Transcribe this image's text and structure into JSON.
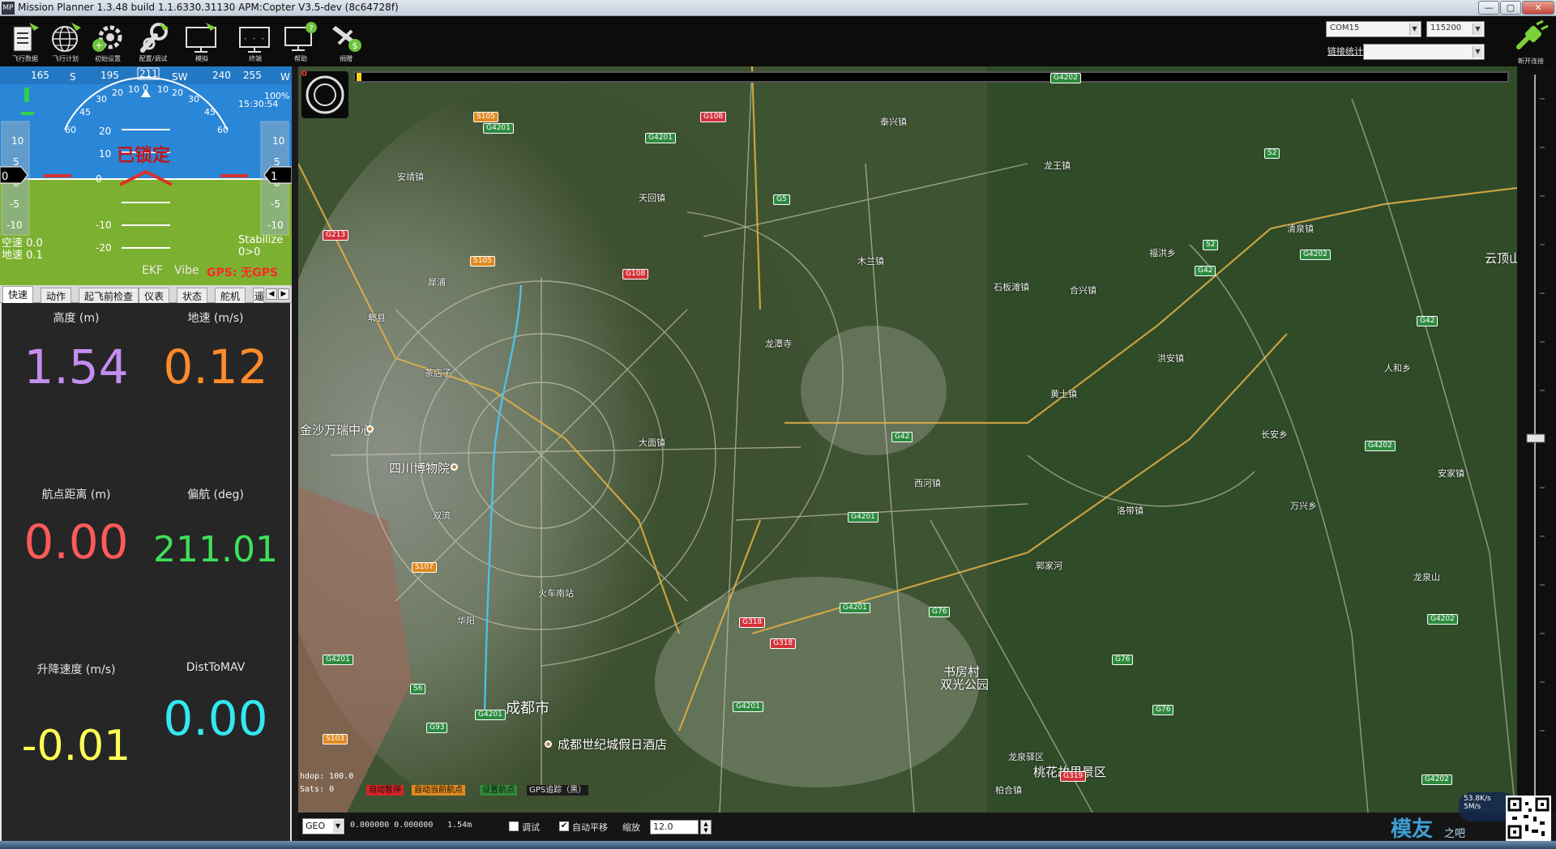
{
  "window": {
    "title": "Mission Planner 1.3.48 build 1.1.6330.31130 APM:Copter V3.5-dev (8c64728f)",
    "app_icon": "mp-app-icon"
  },
  "toolbar": {
    "buttons": [
      {
        "label": "飞行数据",
        "icon": "flight-data-icon"
      },
      {
        "label": "飞行计划",
        "icon": "globe-icon"
      },
      {
        "label": "初始设置",
        "icon": "gear-plus-icon"
      },
      {
        "label": "配置/调试",
        "icon": "wrench-icon"
      },
      {
        "label": "模拟",
        "icon": "monitor-plane-icon"
      },
      {
        "label": "终端",
        "icon": "terminal-icon"
      },
      {
        "label": "帮助",
        "icon": "help-monitor-icon"
      },
      {
        "label": "捐赠",
        "icon": "donate-plane-icon"
      }
    ],
    "com_port": "COM15",
    "baud_rate": "115200",
    "link_stats_label": "链接统计",
    "disconnect_label": "断开连接"
  },
  "hud": {
    "heading_ticks": [
      "165",
      "S",
      "195",
      "211",
      "SW",
      "240",
      "255",
      "W"
    ],
    "pitch_ticks_up": [
      "10",
      "20"
    ],
    "pitch_ticks_down": [
      "0",
      "-10",
      "-20"
    ],
    "left_scale": [
      "10",
      "5",
      "0",
      "-5",
      "-10"
    ],
    "right_scale": [
      "10",
      "5",
      "0",
      "-5",
      "-10"
    ],
    "left_box": "0",
    "right_box": "1",
    "roll_ticks": [
      "60",
      "45",
      "30",
      "20",
      "10",
      "0",
      "10",
      "20",
      "30",
      "45",
      "60"
    ],
    "locked_text": "已锁定",
    "airspeed": "空速 0.0",
    "groundspeed": "地速 0.1",
    "mode": "Stabilize",
    "mode2": "0>0",
    "time": "15:30:54",
    "battery": "100%",
    "ekf": "EKF",
    "vibe": "Vibe",
    "gps_status": "GPS: 无GPS",
    "colors": {
      "sky": "#2a86d6",
      "ground": "#7cb030",
      "warning": "#ff2828"
    }
  },
  "tabs": {
    "items": [
      "快速",
      "动作",
      "起飞前检查",
      "仪表",
      "状态",
      "舵机",
      "遥"
    ],
    "active_index": 0
  },
  "quick": {
    "items": [
      {
        "label": "高度 (m)",
        "value": "1.54",
        "color": "#c38ef0"
      },
      {
        "label": "地速 (m/s)",
        "value": "0.12",
        "color": "#ff8a2a"
      },
      {
        "label": "航点距离 (m)",
        "value": "0.00",
        "color": "#ff5a5a"
      },
      {
        "label": "偏航 (deg)",
        "value": "211.01",
        "color": "#3ee05a"
      },
      {
        "label": "升降速度 (m/s)",
        "value": "-0.01",
        "color": "#ffff55"
      },
      {
        "label": "DistToMAV",
        "value": "0.00",
        "color": "#33e8f0"
      }
    ]
  },
  "map": {
    "zero_marker": "0",
    "place_labels": [
      {
        "text": "金沙万瑞中心",
        "big": true
      },
      {
        "text": "四川博物院",
        "big": true
      },
      {
        "text": "成都市",
        "big": true
      },
      {
        "text": "成都世纪城假日酒店",
        "big": true
      },
      {
        "text": "书房村",
        "big": true
      },
      {
        "text": "双光公园",
        "big": true
      },
      {
        "text": "桃花故里景区",
        "big": true
      },
      {
        "text": "云顶山",
        "big": true
      },
      {
        "text": "安靖镇",
        "big": false
      },
      {
        "text": "天回镇",
        "big": false
      },
      {
        "text": "泰兴镇",
        "big": false
      },
      {
        "text": "龙王镇",
        "big": false
      },
      {
        "text": "木兰镇",
        "big": false
      },
      {
        "text": "石板滩镇",
        "big": false
      },
      {
        "text": "合兴镇",
        "big": false
      },
      {
        "text": "清泉镇",
        "big": false
      },
      {
        "text": "福洪乡",
        "big": false
      },
      {
        "text": "黄土镇",
        "big": false
      },
      {
        "text": "洪安镇",
        "big": false
      },
      {
        "text": "龙潭寺",
        "big": false
      },
      {
        "text": "西河镇",
        "big": false
      },
      {
        "text": "洛带镇",
        "big": false
      },
      {
        "text": "长安乡",
        "big": false
      },
      {
        "text": "万兴乡",
        "big": false
      },
      {
        "text": "人和乡",
        "big": false
      },
      {
        "text": "安家镇",
        "big": false
      },
      {
        "text": "龙泉驿区",
        "big": false
      },
      {
        "text": "柏合镇",
        "big": false
      },
      {
        "text": "大面镇",
        "big": false
      },
      {
        "text": "茶店子",
        "big": false
      },
      {
        "text": "犀浦",
        "big": false
      },
      {
        "text": "郫县",
        "big": false
      },
      {
        "text": "双流",
        "big": false
      },
      {
        "text": "华阳",
        "big": false
      },
      {
        "text": "火车南站",
        "big": false
      },
      {
        "text": "龙泉山",
        "big": false
      },
      {
        "text": "郭家河",
        "big": false
      }
    ],
    "road_shields": [
      {
        "text": "G4202",
        "kind": "g"
      },
      {
        "text": "G4201",
        "kind": "g"
      },
      {
        "text": "G4201",
        "kind": "g"
      },
      {
        "text": "G4201",
        "kind": "g"
      },
      {
        "text": "G4201",
        "kind": "g"
      },
      {
        "text": "G4201",
        "kind": "g"
      },
      {
        "text": "G4201",
        "kind": "g"
      },
      {
        "text": "G4201",
        "kind": "g"
      },
      {
        "text": "G4202",
        "kind": "g"
      },
      {
        "text": "G4202",
        "kind": "g"
      },
      {
        "text": "G4202",
        "kind": "g"
      },
      {
        "text": "G4202",
        "kind": "g"
      },
      {
        "text": "G42",
        "kind": "g"
      },
      {
        "text": "G42",
        "kind": "g"
      },
      {
        "text": "G42",
        "kind": "g"
      },
      {
        "text": "G76",
        "kind": "g"
      },
      {
        "text": "G76",
        "kind": "g"
      },
      {
        "text": "G76",
        "kind": "g"
      },
      {
        "text": "G5",
        "kind": "g"
      },
      {
        "text": "S2",
        "kind": "g"
      },
      {
        "text": "S2",
        "kind": "g"
      },
      {
        "text": "G93",
        "kind": "g"
      },
      {
        "text": "S6",
        "kind": "g"
      },
      {
        "text": "G108",
        "kind": "r"
      },
      {
        "text": "G108",
        "kind": "r"
      },
      {
        "text": "G213",
        "kind": "r"
      },
      {
        "text": "G318",
        "kind": "r"
      },
      {
        "text": "G318",
        "kind": "r"
      },
      {
        "text": "G319",
        "kind": "r"
      },
      {
        "text": "S105",
        "kind": "o"
      },
      {
        "text": "S105",
        "kind": "o"
      },
      {
        "text": "S107",
        "kind": "o"
      },
      {
        "text": "S103",
        "kind": "o"
      }
    ],
    "status": {
      "hdop": "hdop: 100.0",
      "sats": "Sats: 0",
      "buttons": [
        {
          "text": "自动暂停",
          "color": "#d62424"
        },
        {
          "text": "自动当前航点",
          "color": "#e08a1e"
        },
        {
          "text": "设置航点",
          "color": "#2f8a38"
        },
        {
          "text": "GPS追踪（黑）",
          "color": "#e6e6e6"
        }
      ]
    }
  },
  "bottom": {
    "coord_system": "GEO",
    "coords": "0.000000 0.000000",
    "altitude": "1.54m",
    "debug_label": "调试",
    "debug_checked": false,
    "autopan_label": "自动平移",
    "autopan_checked": true,
    "zoom_label": "缩放",
    "zoom_value": "12.0"
  },
  "overlay": {
    "watermark": "模友",
    "watermark2": "之吧",
    "net_up": "53.8K/s",
    "net_down": "5M/s"
  }
}
